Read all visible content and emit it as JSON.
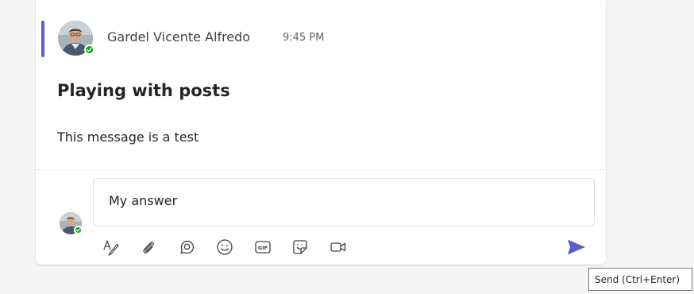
{
  "post": {
    "author": "Gardel Vicente Alfredo",
    "time": "9:45 PM",
    "subject": "Playing with posts",
    "message": "This message is a test",
    "presence": "available"
  },
  "reply": {
    "value": "My answer"
  },
  "toolbar": {
    "icons": [
      "format-icon",
      "attach-icon",
      "loop-icon",
      "emoji-icon",
      "gif-icon",
      "sticker-icon",
      "meet-now-icon",
      "send-icon"
    ]
  },
  "tooltip": {
    "text": "Send (Ctrl+Enter)"
  },
  "colors": {
    "accent": "#5b5fc7",
    "presence": "#13a10e",
    "send": "#5b5fc7"
  }
}
